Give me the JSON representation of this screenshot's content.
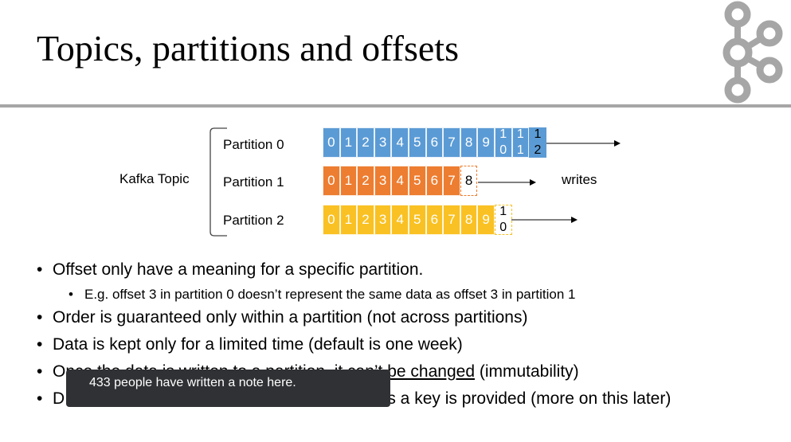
{
  "slide": {
    "title": "Topics, partitions and offsets",
    "topic_label": "Kafka Topic",
    "writes_label": "writes",
    "partitions": [
      {
        "label": "Partition 0",
        "offsets": [
          "0",
          "1",
          "2",
          "3",
          "4",
          "5",
          "6",
          "7",
          "8",
          "9"
        ],
        "stacked_offsets": [
          [
            "1",
            "0"
          ],
          [
            "1",
            "1"
          ]
        ],
        "next_offset": [
          "1",
          "2"
        ],
        "color": "#5b9bd5"
      },
      {
        "label": "Partition 1",
        "offsets": [
          "0",
          "1",
          "2",
          "3",
          "4",
          "5",
          "6",
          "7"
        ],
        "stacked_offsets": [],
        "next_offset": [
          "8"
        ],
        "color": "#ed7d31"
      },
      {
        "label": "Partition 2",
        "offsets": [
          "0",
          "1",
          "2",
          "3",
          "4",
          "5",
          "6",
          "7",
          "8",
          "9"
        ],
        "stacked_offsets": [],
        "next_offset": [
          "1",
          "0"
        ],
        "color": "#f9c123"
      }
    ],
    "bullets": [
      {
        "text": "Offset only have a meaning for a specific partition."
      },
      {
        "text": "E.g. offset 3 in partition 0 doesn’t represent the same data as offset 3 in partition 1"
      },
      {
        "text": "Order is guaranteed only within a partition (not across partitions)"
      },
      {
        "text": "Data is kept only for a limited time (default is one week)"
      },
      {
        "text_before": "Once the data is written to a partition, ",
        "underlined": "it can’t be changed",
        "text_after": " (immutability)"
      },
      {
        "text_visible_start": "D",
        "text_visible_end": "ess a key is provided (more on this later)"
      }
    ]
  },
  "tooltip": {
    "text": "433 people have written a note here."
  },
  "colors": {
    "rule": "#a6a6a6",
    "logo": "#a6a6a6",
    "tooltip_bg": "#2f3134"
  }
}
